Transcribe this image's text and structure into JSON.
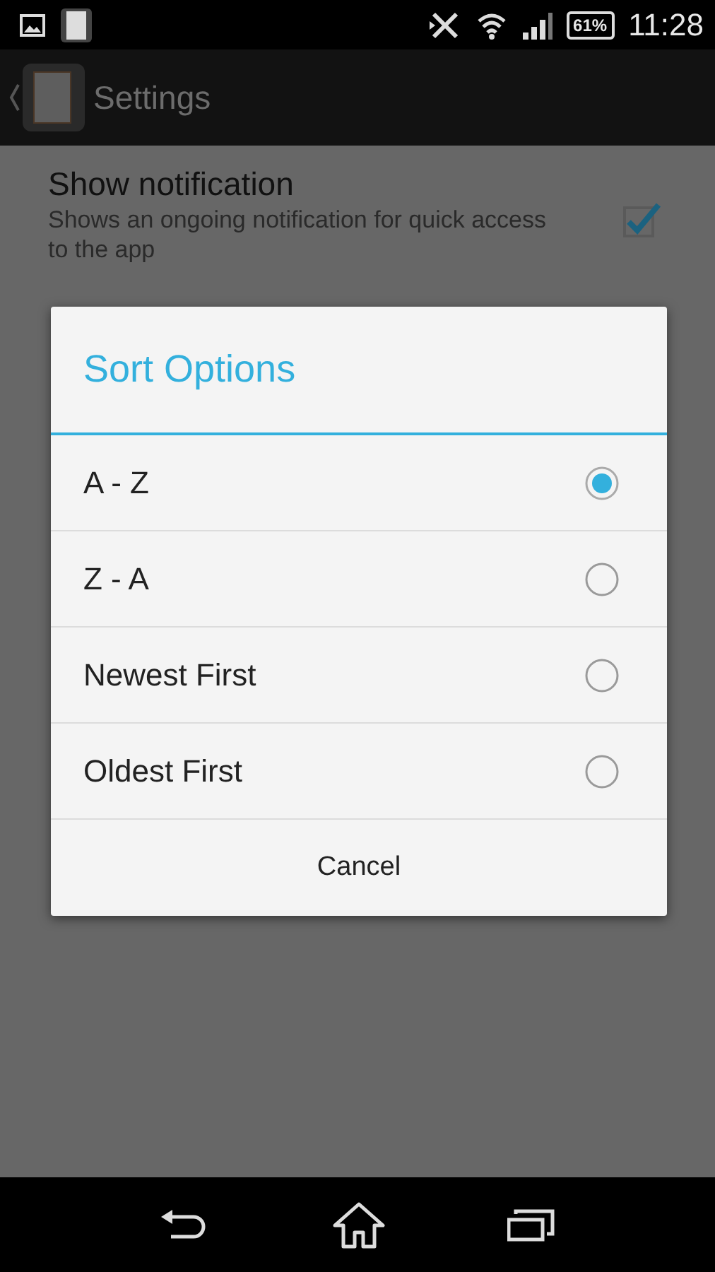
{
  "status_bar": {
    "battery": "61%",
    "time": "11:28"
  },
  "action_bar": {
    "title": "Settings"
  },
  "settings": [
    {
      "title": "Show notification",
      "summary": "Shows an ongoing notification for quick access to the app",
      "checked": true
    }
  ],
  "dialog": {
    "title": "Sort Options",
    "options": [
      {
        "label": "A - Z",
        "selected": true
      },
      {
        "label": "Z - A",
        "selected": false
      },
      {
        "label": "Newest First",
        "selected": false
      },
      {
        "label": "Oldest First",
        "selected": false
      }
    ],
    "cancel": "Cancel"
  }
}
